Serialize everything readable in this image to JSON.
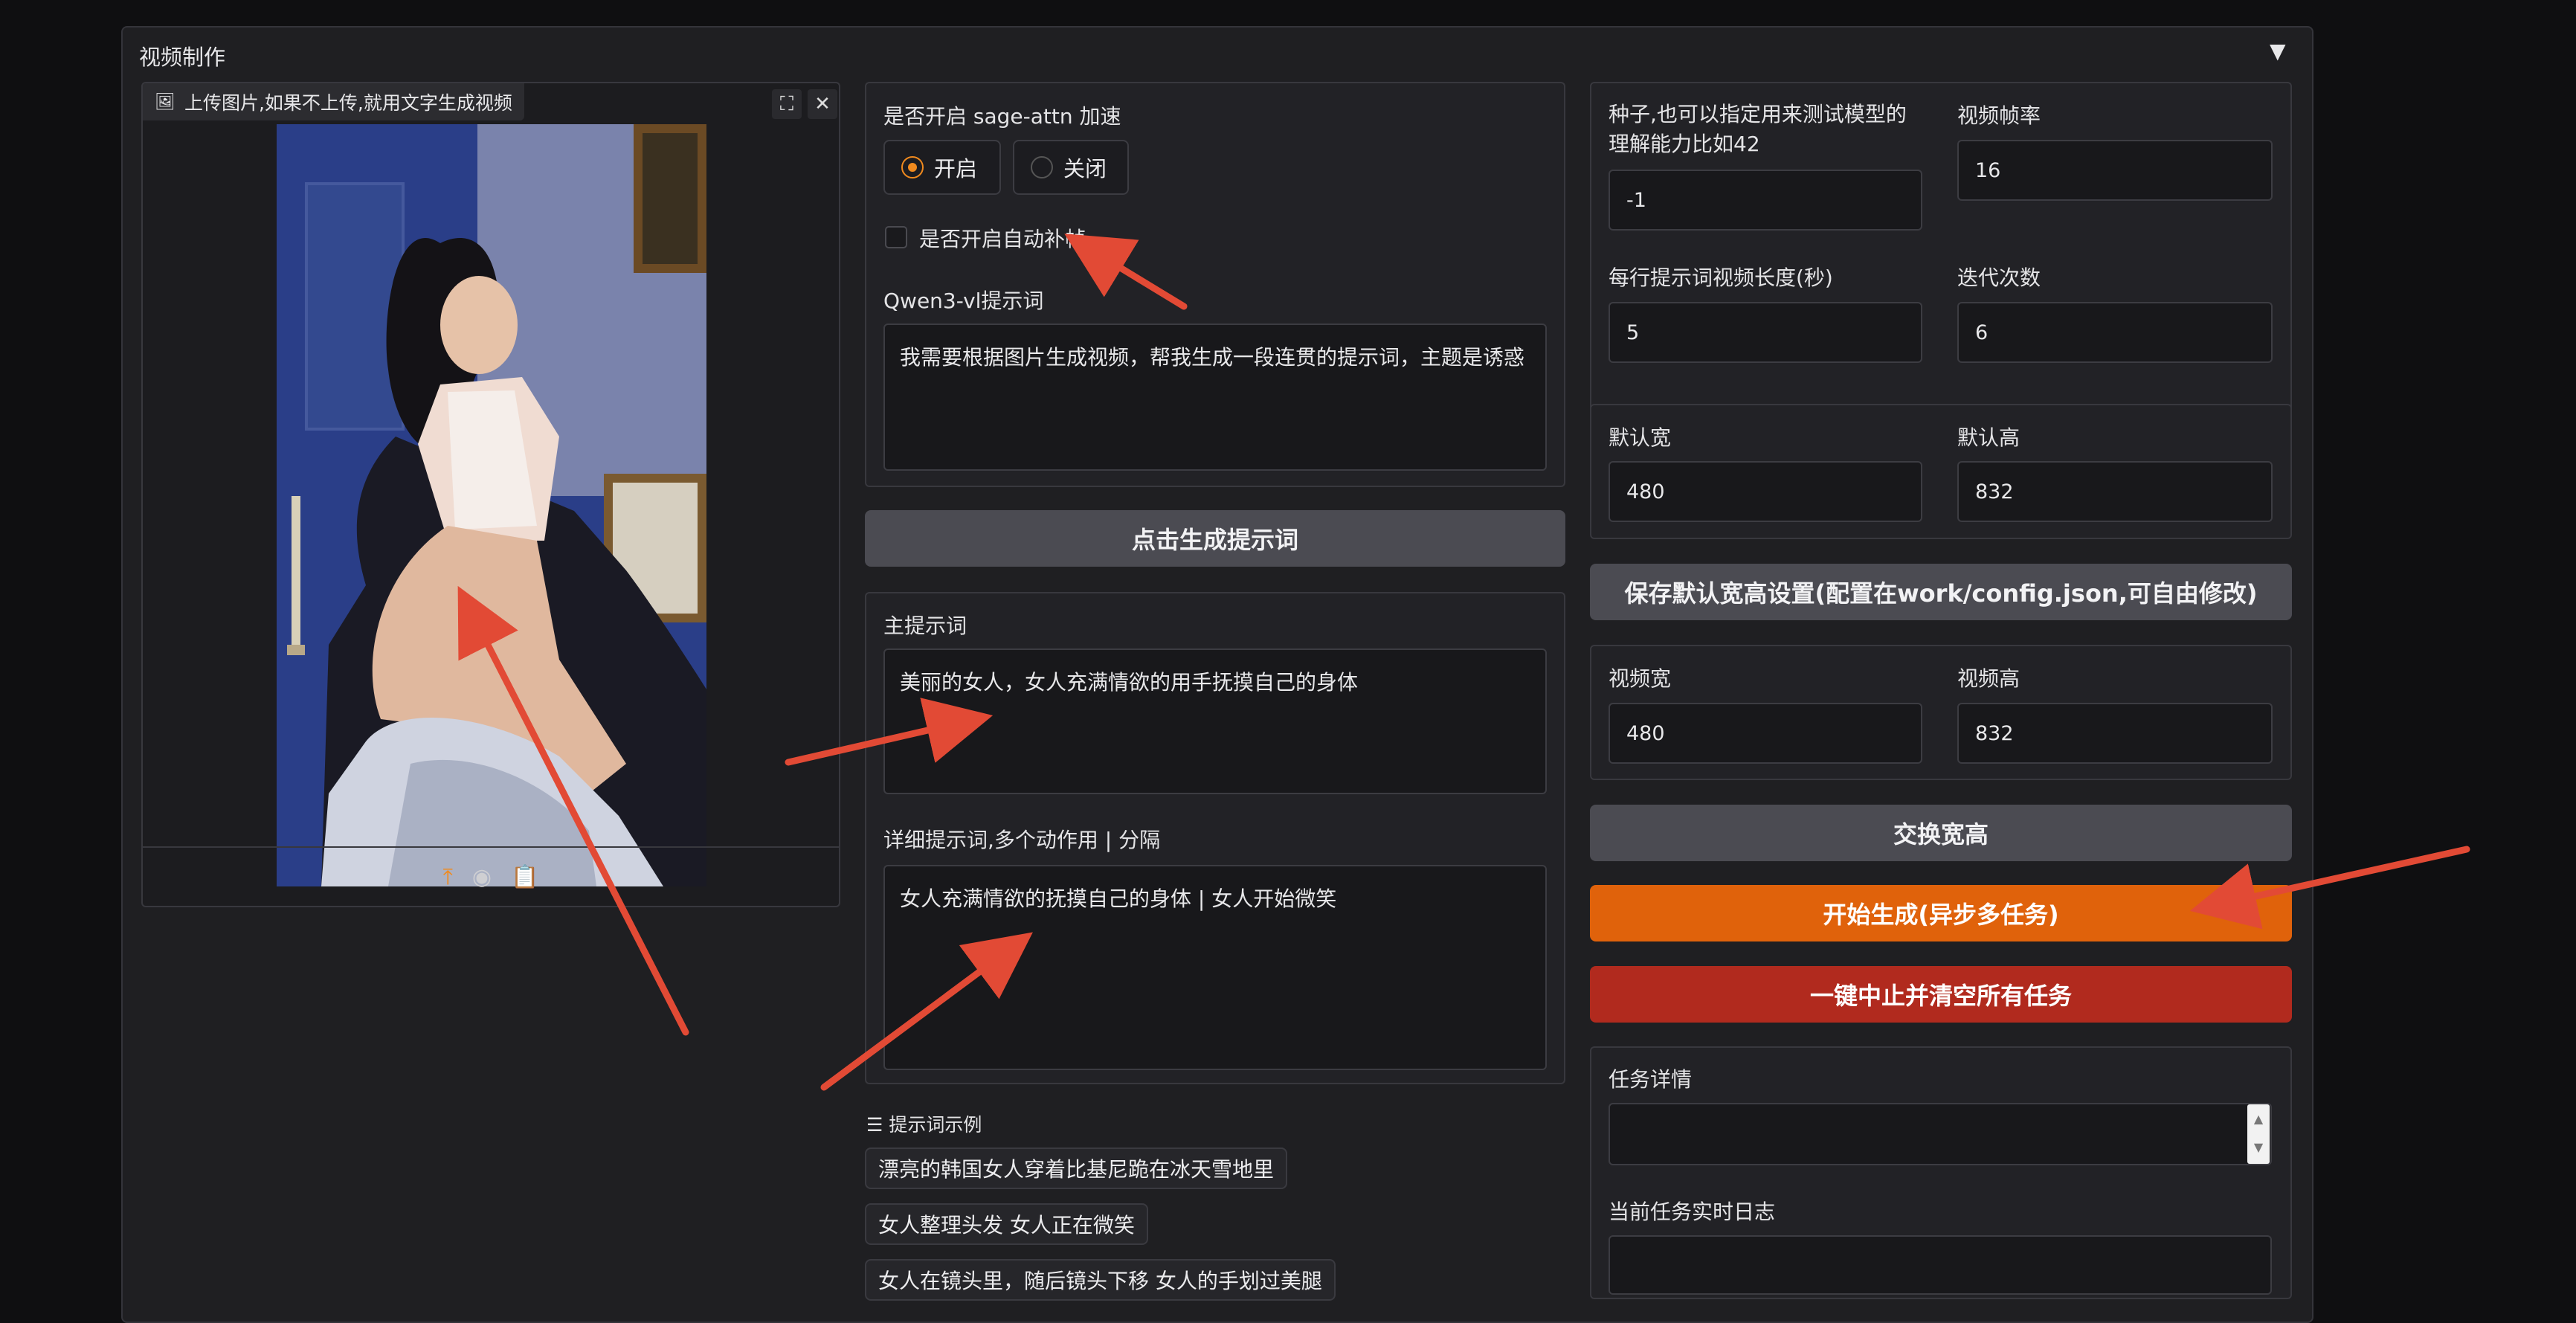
{
  "panel": {
    "title": "视频制作",
    "collapse_icon": "triangle-down-icon"
  },
  "image_upload": {
    "label": "上传图片,如果不上传,就用文字生成视频",
    "tools": [
      "fullscreen-icon",
      "close-icon"
    ],
    "bottom_icons": [
      "upload-icon",
      "webcam-icon",
      "clipboard-icon"
    ]
  },
  "sage_attn": {
    "label": "是否开启 sage-attn 加速",
    "options": [
      "开启",
      "关闭"
    ],
    "selected": "开启"
  },
  "auto_interp": {
    "label": "是否开启自动补帧",
    "checked": false
  },
  "qwen_prompt": {
    "label": "Qwen3-vl提示词",
    "value": "我需要根据图片生成视频，帮我生成一段连贯的提示词，主题是诱惑"
  },
  "gen_prompt_button": "点击生成提示词",
  "main_prompt": {
    "label": "主提示词",
    "value": "美丽的女人，女人充满情欲的用手抚摸自己的身体"
  },
  "detail_prompt": {
    "label": "详细提示词,多个动作用 | 分隔",
    "value": "女人充满情欲的抚摸自己的身体 | 女人开始微笑"
  },
  "examples": {
    "label": "提示词示例",
    "items": [
      "漂亮的韩国女人穿着比基尼跪在冰天雪地里",
      "女人整理头发 女人正在微笑",
      "女人在镜头里，随后镜头下移 女人的手划过美腿"
    ]
  },
  "seed": {
    "label_line1": "种子,也可以指定用来测试模型的",
    "label_line2": "理解能力比如42",
    "value": "-1"
  },
  "fps": {
    "label": "视频帧率",
    "value": "16"
  },
  "segment_len": {
    "label": "每行提示词视频长度(秒)",
    "value": "5"
  },
  "iterations": {
    "label": "迭代次数",
    "value": "6"
  },
  "default_w": {
    "label": "默认宽",
    "value": "480"
  },
  "default_h": {
    "label": "默认高",
    "value": "832"
  },
  "save_button": "保存默认宽高设置(配置在work/config.json,可自由修改)",
  "video_w": {
    "label": "视频宽",
    "value": "480"
  },
  "video_h": {
    "label": "视频高",
    "value": "832"
  },
  "swap_button": "交换宽高",
  "start_button": "开始生成(异步多任务)",
  "stop_button": "一键中止并清空所有任务",
  "task_detail": {
    "label": "任务详情",
    "value": ""
  },
  "task_log": {
    "label": "当前任务实时日志",
    "value": ""
  },
  "colors": {
    "accent_orange": "#e0620b",
    "danger_red": "#b12a1e",
    "annotation_arrow": "#e24a35"
  }
}
